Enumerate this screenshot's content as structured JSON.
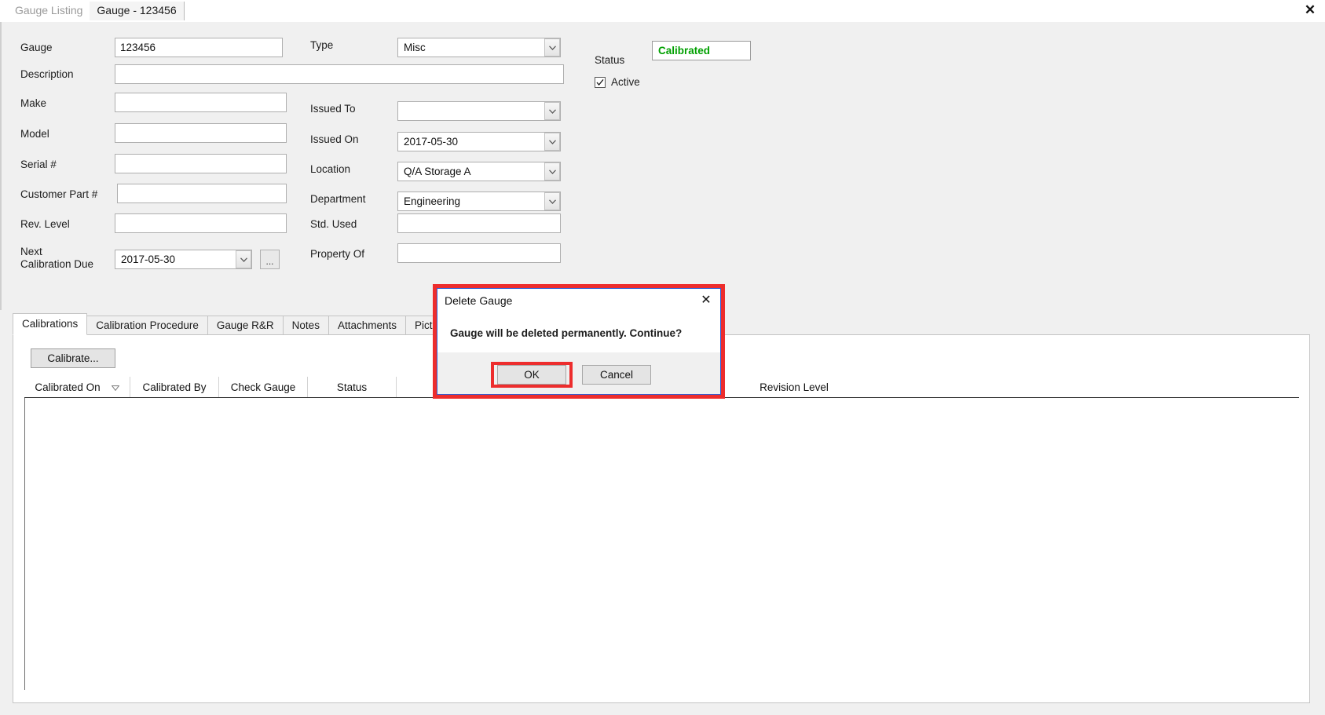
{
  "window": {
    "close_icon": "close-icon",
    "tabs": [
      {
        "label": "Gauge Listing",
        "active": false
      },
      {
        "label": "Gauge - 123456",
        "active": true
      }
    ]
  },
  "form": {
    "fields": {
      "gauge": {
        "label": "Gauge",
        "value": "123456"
      },
      "description": {
        "label": "Description",
        "value": ""
      },
      "make": {
        "label": "Make",
        "value": ""
      },
      "model": {
        "label": "Model",
        "value": ""
      },
      "serial": {
        "label": "Serial #",
        "value": ""
      },
      "customer_part": {
        "label": "Customer Part #",
        "value": ""
      },
      "rev_level": {
        "label": "Rev. Level",
        "value": ""
      },
      "next_calibration_due": {
        "label_line1": "Next",
        "label_line2": "Calibration Due",
        "value": "2017-05-30"
      },
      "ellipsis_button": "...",
      "type": {
        "label": "Type",
        "value": "Misc"
      },
      "issued_to": {
        "label": "Issued To",
        "value": ""
      },
      "issued_on": {
        "label": "Issued On",
        "value": "2017-05-30"
      },
      "location": {
        "label": "Location",
        "value": "Q/A Storage A"
      },
      "department": {
        "label": "Department",
        "value": "Engineering"
      },
      "std_used": {
        "label": "Std. Used",
        "value": ""
      },
      "property_of": {
        "label": "Property Of",
        "value": ""
      },
      "status": {
        "label": "Status",
        "value": "Calibrated",
        "color": "#00a000"
      },
      "active": {
        "label": "Active",
        "checked": true
      }
    }
  },
  "lower": {
    "tabs": [
      {
        "label": "Calibrations",
        "active": true
      },
      {
        "label": "Calibration Procedure",
        "active": false
      },
      {
        "label": "Gauge R&R",
        "active": false
      },
      {
        "label": "Notes",
        "active": false
      },
      {
        "label": "Attachments",
        "active": false
      },
      {
        "label": "Pictures",
        "active": false
      }
    ],
    "calibrate_button": "Calibrate...",
    "grid": {
      "columns": [
        {
          "label": "Calibrated On",
          "sorted": "desc"
        },
        {
          "label": "Calibrated By",
          "sorted": ""
        },
        {
          "label": "Check Gauge",
          "sorted": ""
        },
        {
          "label": "Status",
          "sorted": ""
        },
        {
          "label": "Revision Level",
          "sorted": ""
        }
      ],
      "rows": []
    }
  },
  "dialog": {
    "title": "Delete Gauge",
    "close_icon": "close-icon",
    "message": "Gauge will be deleted permanently.  Continue?",
    "ok_label": "OK",
    "cancel_label": "Cancel",
    "highlight_color": "#ed2d2d"
  }
}
